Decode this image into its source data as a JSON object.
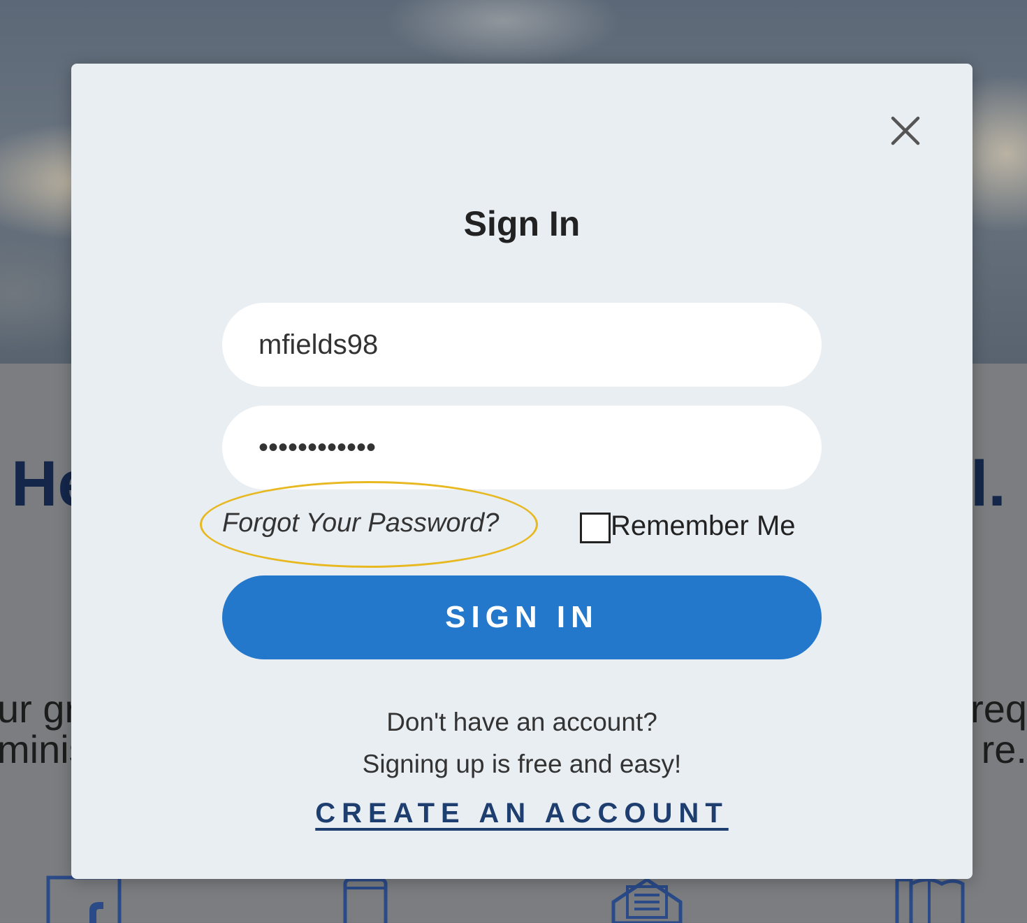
{
  "background": {
    "heading_left": "He",
    "heading_right": "l.",
    "text_left_line1": "ur gr",
    "text_left_line2": "minis",
    "text_right_line1": "req",
    "text_right_line2": "re."
  },
  "modal": {
    "title": "Sign In",
    "username_value": "mfields98",
    "password_value": "••••••••••••",
    "forgot_password": "Forgot Your Password?",
    "remember_me": "Remember Me",
    "remember_checked": false,
    "sign_in_button": "SIGN IN",
    "no_account_line1": "Don't have an account?",
    "no_account_line2": "Signing up is free and easy!",
    "create_account": "CREATE AN ACCOUNT"
  },
  "colors": {
    "primary_button": "#2478cc",
    "highlight_ring": "#e7b820",
    "link_color": "#1e3e6f",
    "modal_bg": "#e9eef3"
  },
  "icons": {
    "close": "close-icon",
    "background_icons": [
      "facebook-icon",
      "phone-icon",
      "mail-icon",
      "book-icon"
    ]
  }
}
